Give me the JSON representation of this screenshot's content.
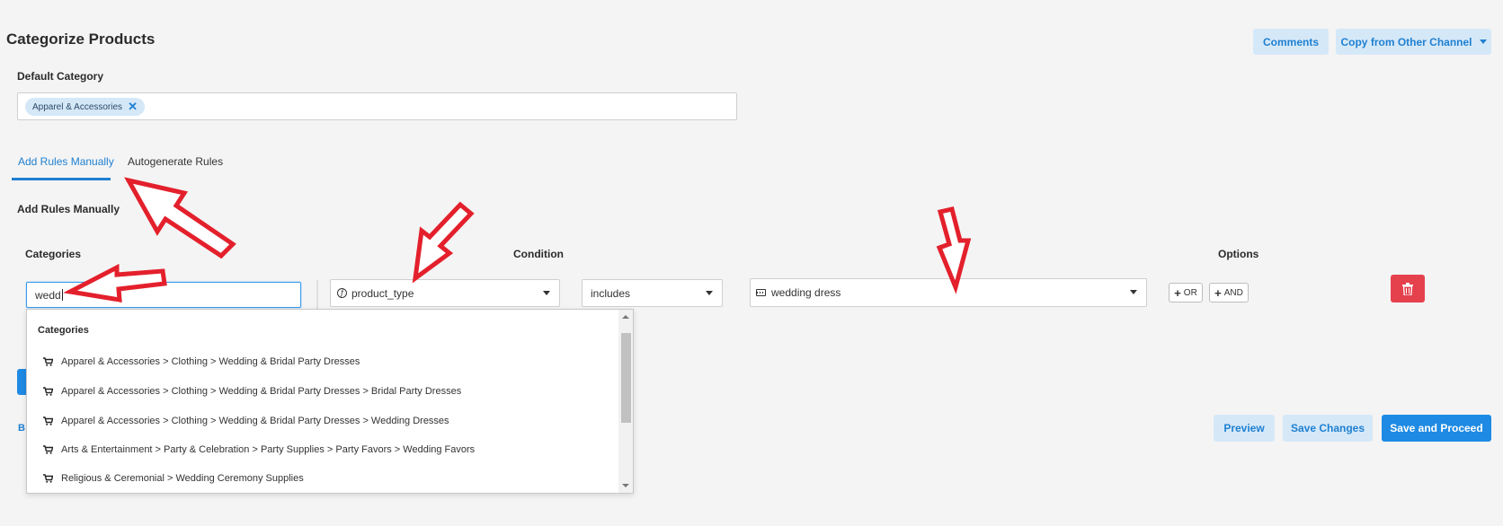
{
  "header": {
    "title": "Categorize Products",
    "comments_label": "Comments",
    "copy_label": "Copy from Other Channel"
  },
  "default_category": {
    "label": "Default Category",
    "chip": "Apparel & Accessories",
    "chip_remove": "✕"
  },
  "tabs": [
    {
      "label": "Add Rules Manually",
      "active": true
    },
    {
      "label": "Autogenerate Rules",
      "active": false
    }
  ],
  "rules": {
    "section_title": "Add Rules Manually",
    "columns": {
      "categories": "Categories",
      "condition": "Condition",
      "options": "Options"
    },
    "category_input_value": "wedd",
    "field_select": "product_type",
    "operator_select": "includes",
    "value_select": "wedding dress",
    "or_label": "OR",
    "and_label": "AND"
  },
  "dropdown": {
    "header": "Categories",
    "items": [
      "Apparel & Accessories > Clothing > Wedding & Bridal Party Dresses",
      "Apparel & Accessories > Clothing > Wedding & Bridal Party Dresses > Bridal Party Dresses",
      "Apparel & Accessories > Clothing > Wedding & Bridal Party Dresses > Wedding Dresses",
      "Arts & Entertainment > Party & Celebration > Party Supplies > Party Favors > Wedding Favors",
      "Religious & Ceremonial > Wedding Ceremony Supplies"
    ]
  },
  "footer": {
    "partial_link": "B",
    "preview_label": "Preview",
    "save_changes_label": "Save Changes",
    "save_proceed_label": "Save and Proceed"
  },
  "colors": {
    "accent": "#1e8ae3",
    "light_button": "#d5e8f8",
    "danger": "#e5414d",
    "annotation_arrow": "#e3202c"
  },
  "icons": [
    "chevron-down-icon",
    "function-icon",
    "keyboard-icon",
    "trash-icon",
    "cart-icon",
    "plus-icon",
    "close-icon"
  ]
}
